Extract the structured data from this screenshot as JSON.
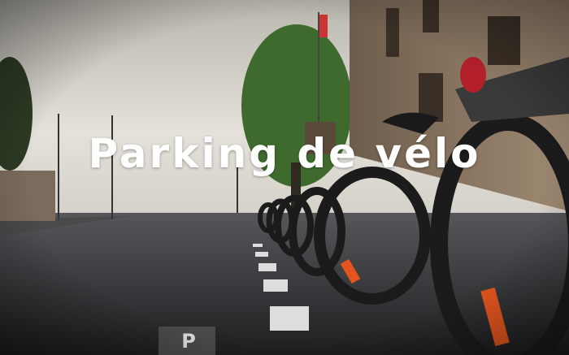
{
  "title": "Parking de vélo",
  "ground_marking": "P",
  "colors": {
    "sky": "#d9d6cf",
    "road": "#2b2b2d",
    "building": "#8a7560",
    "tree": "#3f6a2e",
    "bike_tire": "#1b1b1b",
    "accent_orange": "#e2551e"
  }
}
